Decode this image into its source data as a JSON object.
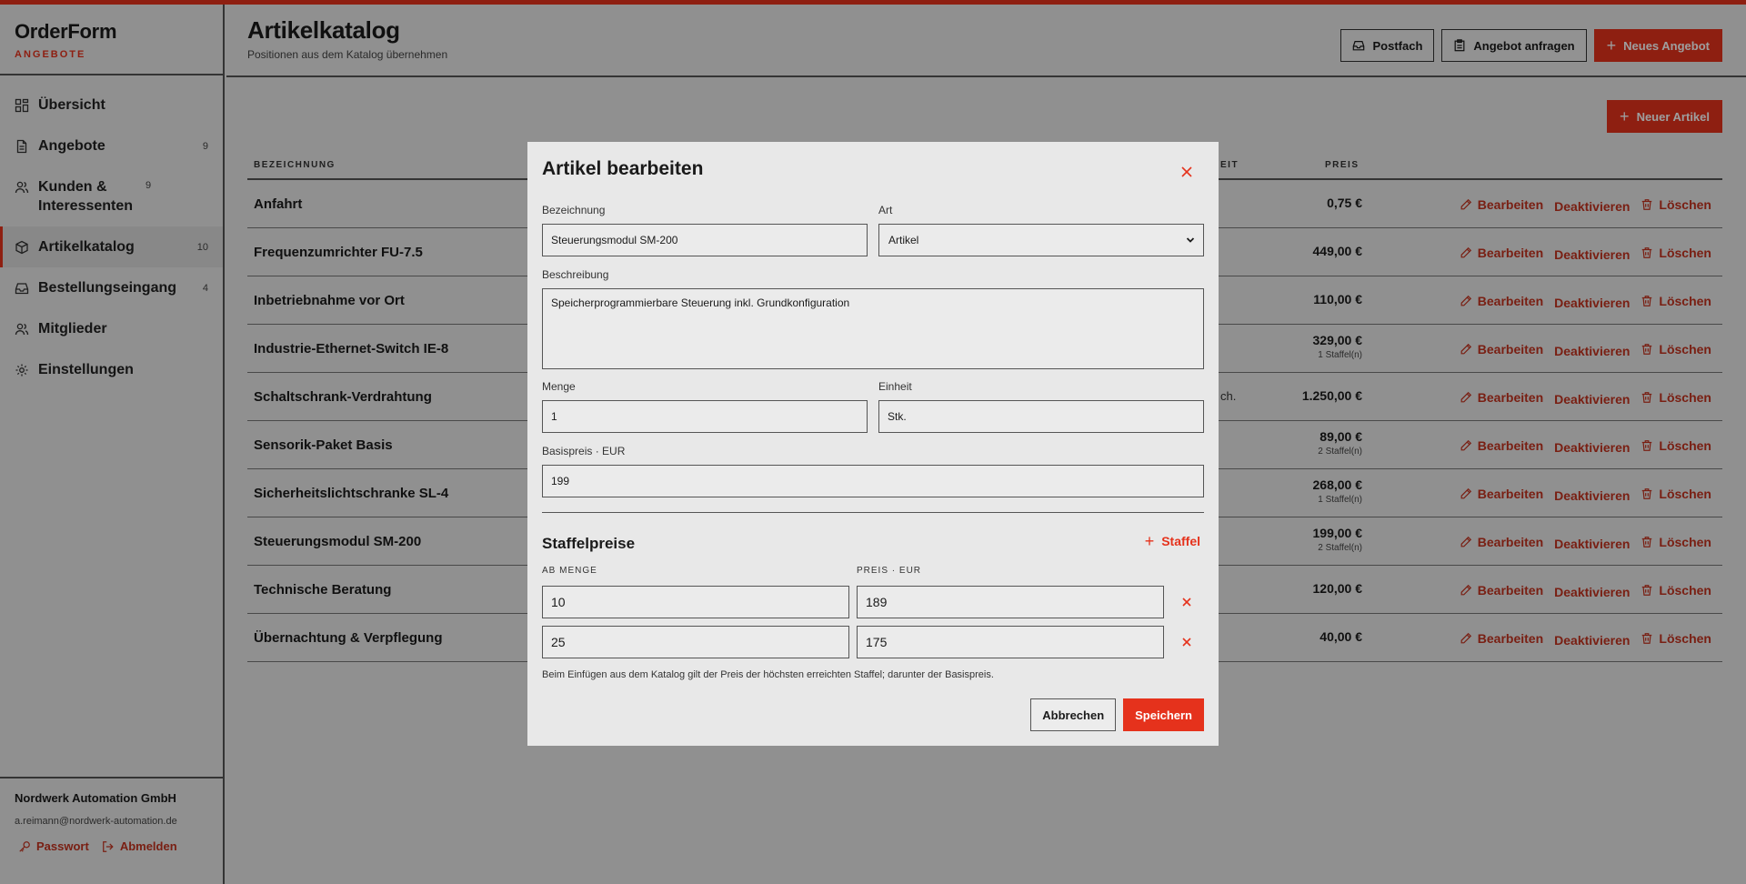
{
  "brand": {
    "title": "OrderForm",
    "subtitle": "ANGEBOTE"
  },
  "colors": {
    "accent": "#e5321c",
    "text": "#1a1a1a"
  },
  "sidebar": {
    "items": [
      {
        "label": "Übersicht",
        "count": "",
        "icon": "grid-icon"
      },
      {
        "label": "Angebote",
        "count": "9",
        "icon": "document-icon"
      },
      {
        "label": "Kunden & Interessenten",
        "count": "9",
        "icon": "users-icon"
      },
      {
        "label": "Artikelkatalog",
        "count": "10",
        "icon": "box-icon",
        "active": true
      },
      {
        "label": "Bestellungseingang",
        "count": "4",
        "icon": "inbox-icon"
      },
      {
        "label": "Mitglieder",
        "count": "",
        "icon": "users-icon"
      },
      {
        "label": "Einstellungen",
        "count": "",
        "icon": "gear-icon"
      }
    ],
    "footer": {
      "company": "Nordwerk Automation GmbH",
      "email": "a.reimann@nordwerk-automation.de",
      "password_label": "Passwort",
      "logout_label": "Abmelden"
    }
  },
  "header": {
    "title": "Artikelkatalog",
    "subtitle": "Positionen aus dem Katalog übernehmen",
    "inbox_label": "Postfach",
    "request_label": "Angebot anfragen",
    "new_offer_label": "Neues Angebot"
  },
  "catalog": {
    "new_article_label": "Neuer Artikel",
    "columns": {
      "name": "BEZEICHNUNG",
      "unit_partial": "EIT",
      "price": "PREIS"
    },
    "action_edit": "Bearbeiten",
    "action_deactivate": "Deaktivieren",
    "action_delete": "Löschen",
    "rows": [
      {
        "name": "Anfahrt",
        "unit": "",
        "price": "0,75 €",
        "tiers": ""
      },
      {
        "name": "Frequenzumrichter FU-7.5",
        "unit": "",
        "price": "449,00 €",
        "tiers": ""
      },
      {
        "name": "Inbetriebnahme vor Ort",
        "unit": "",
        "price": "110,00 €",
        "tiers": ""
      },
      {
        "name": "Industrie-Ethernet-Switch IE-8",
        "unit": "",
        "price": "329,00 €",
        "tiers": "1 Staffel(n)"
      },
      {
        "name": "Schaltschrank-Verdrahtung",
        "unit": "ch.",
        "price": "1.250,00 €",
        "tiers": ""
      },
      {
        "name": "Sensorik-Paket Basis",
        "unit": "",
        "price": "89,00 €",
        "tiers": "2 Staffel(n)"
      },
      {
        "name": "Sicherheitslichtschranke SL-4",
        "unit": "",
        "price": "268,00 €",
        "tiers": "1 Staffel(n)"
      },
      {
        "name": "Steuerungsmodul SM-200",
        "unit": "",
        "price": "199,00 €",
        "tiers": "2 Staffel(n)"
      },
      {
        "name": "Technische Beratung",
        "unit": "",
        "price": "120,00 €",
        "tiers": ""
      },
      {
        "name": "Übernachtung & Verpflegung",
        "unit": "",
        "price": "40,00 €",
        "tiers": ""
      }
    ]
  },
  "modal": {
    "title": "Artikel bearbeiten",
    "name_label": "Bezeichnung",
    "name_value": "Steuerungsmodul SM-200",
    "type_label": "Art",
    "type_value": "Artikel",
    "desc_label": "Beschreibung",
    "desc_value": "Speicherprogrammierbare Steuerung inkl. Grundkonfiguration",
    "qty_label": "Menge",
    "qty_value": "1",
    "unit_label": "Einheit",
    "unit_value": "Stk.",
    "price_label": "Basispreis · EUR",
    "price_value": "199",
    "tiers_title": "Staffelpreise",
    "add_tier_label": "Staffel",
    "col_from": "AB MENGE",
    "col_price": "PREIS · EUR",
    "tiers": [
      {
        "from": "10",
        "price": "189"
      },
      {
        "from": "25",
        "price": "175"
      }
    ],
    "hint": "Beim Einfügen aus dem Katalog gilt der Preis der höchsten erreichten Staffel; darunter der Basispreis.",
    "cancel_label": "Abbrechen",
    "save_label": "Speichern"
  }
}
